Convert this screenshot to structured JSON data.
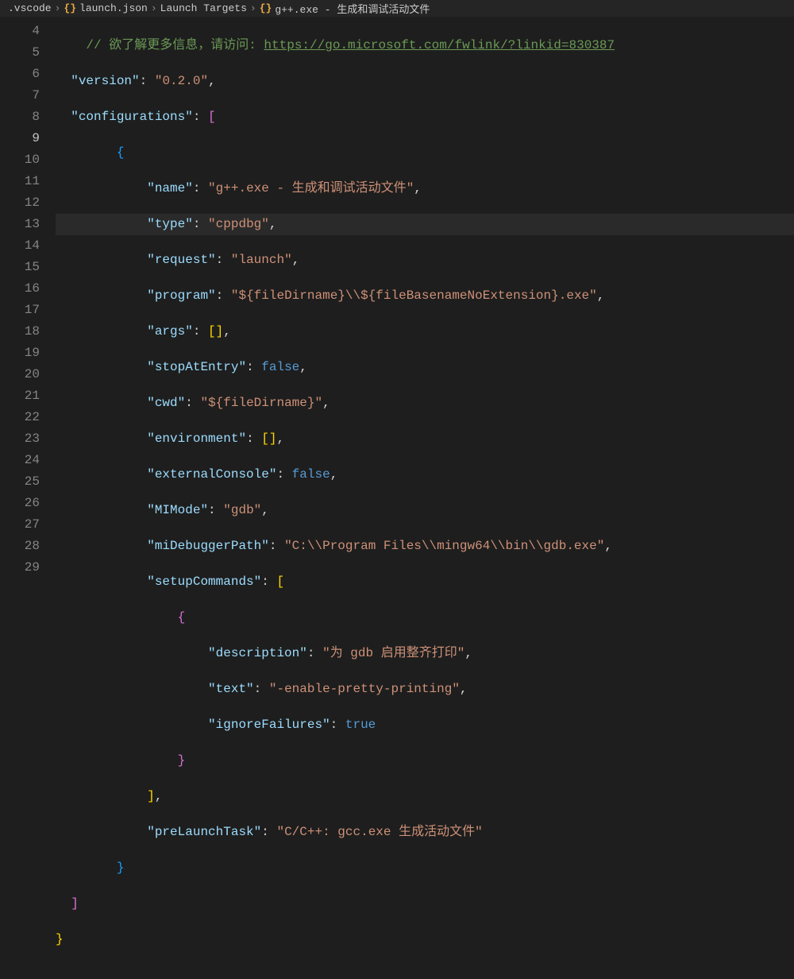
{
  "breadcrumb": {
    "folder": ".vscode",
    "file": "launch.json",
    "section": "Launch Targets",
    "target": "g++.exe - 生成和调试活动文件"
  },
  "lines": {
    "start": 4,
    "end": 29
  },
  "code": {
    "commentPrefix": "// 欲了解更多信息，请访问: ",
    "commentLink": "https://go.microsoft.com/fwlink/?linkid=830387",
    "versionKey": "version",
    "versionVal": "0.2.0",
    "configurationsKey": "configurations",
    "nameKey": "name",
    "nameVal": "g++.exe - 生成和调试活动文件",
    "typeKey": "type",
    "typeVal": "cppdbg",
    "requestKey": "request",
    "requestVal": "launch",
    "programKey": "program",
    "programVal": "${fileDirname}\\\\${fileBasenameNoExtension}.exe",
    "argsKey": "args",
    "stopAtEntryKey": "stopAtEntry",
    "stopAtEntryVal": "false",
    "cwdKey": "cwd",
    "cwdVal": "${fileDirname}",
    "environmentKey": "environment",
    "externalConsoleKey": "externalConsole",
    "externalConsoleVal": "false",
    "miModeKey": "MIMode",
    "miModeVal": "gdb",
    "miDebuggerPathKey": "miDebuggerPath",
    "miDebuggerPathVal": "C:\\\\Program Files\\\\mingw64\\\\bin\\\\gdb.exe",
    "setupCommandsKey": "setupCommands",
    "descriptionKey": "description",
    "descriptionVal": "为 gdb 启用整齐打印",
    "textKey": "text",
    "textVal": "-enable-pretty-printing",
    "ignoreFailuresKey": "ignoreFailures",
    "ignoreFailuresVal": "true",
    "preLaunchTaskKey": "preLaunchTask",
    "preLaunchTaskVal": "C/C++: gcc.exe 生成活动文件"
  }
}
